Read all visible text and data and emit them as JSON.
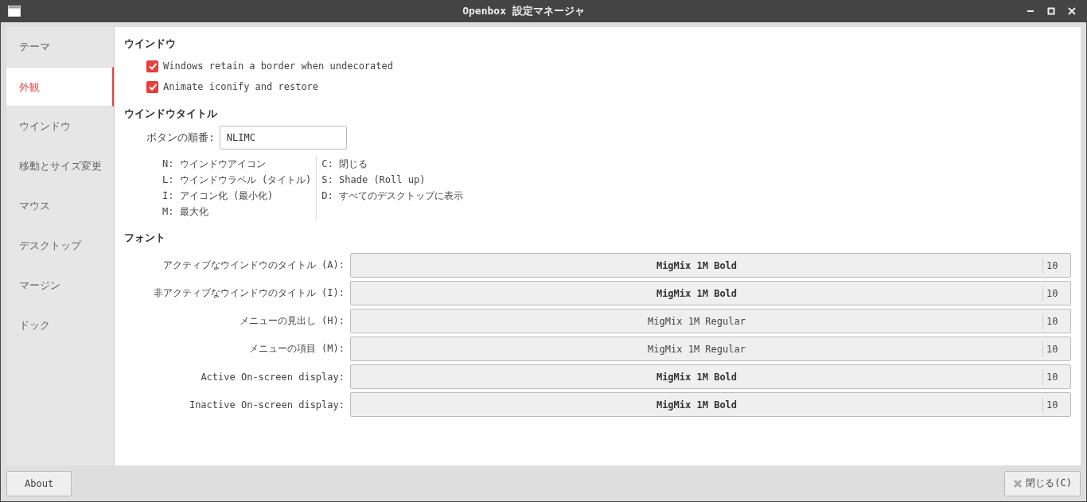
{
  "window": {
    "title": "Openbox 設定マネージャ"
  },
  "sidebar": {
    "items": [
      {
        "label": "テーマ",
        "selected": false
      },
      {
        "label": "外観",
        "selected": true
      },
      {
        "label": "ウインドウ",
        "selected": false
      },
      {
        "label": "移動とサイズ変更",
        "selected": false
      },
      {
        "label": "マウス",
        "selected": false
      },
      {
        "label": "デスクトップ",
        "selected": false
      },
      {
        "label": "マージン",
        "selected": false
      },
      {
        "label": "ドック",
        "selected": false
      }
    ]
  },
  "window_section": {
    "heading": "ウインドウ",
    "options": [
      {
        "label": "Windows retain a border when undecorated",
        "checked": true
      },
      {
        "label": "Animate iconify and restore",
        "checked": true
      }
    ]
  },
  "title_section": {
    "heading": "ウインドウタイトル",
    "order_label": "ボタンの順番:",
    "order_value": "NLIMC",
    "legend_left": [
      "N: ウインドウアイコン",
      "L: ウインドウラベル (タイトル)",
      "I: アイコン化 (最小化)",
      "M: 最大化"
    ],
    "legend_right": [
      "C: 閉じる",
      "S: Shade (Roll up)",
      "D: すべてのデスクトップに表示"
    ]
  },
  "font_section": {
    "heading": "フォント",
    "fonts": [
      {
        "label": "アクティブなウインドウのタイトル (A):",
        "font": "MigMix 1M Bold",
        "bold": true,
        "size": "10"
      },
      {
        "label": "非アクティブなウインドウのタイトル (I):",
        "font": "MigMix 1M Bold",
        "bold": true,
        "size": "10"
      },
      {
        "label": "メニューの見出し (H):",
        "font": "MigMix 1M Regular",
        "bold": false,
        "size": "10"
      },
      {
        "label": "メニューの項目 (M):",
        "font": "MigMix 1M Regular",
        "bold": false,
        "size": "10"
      },
      {
        "label": "Active On-screen display:",
        "font": "MigMix 1M Bold",
        "bold": true,
        "size": "10"
      },
      {
        "label": "Inactive On-screen display:",
        "font": "MigMix 1M Bold",
        "bold": true,
        "size": "10"
      }
    ]
  },
  "footer": {
    "about": "About",
    "close": "閉じる(C)"
  }
}
